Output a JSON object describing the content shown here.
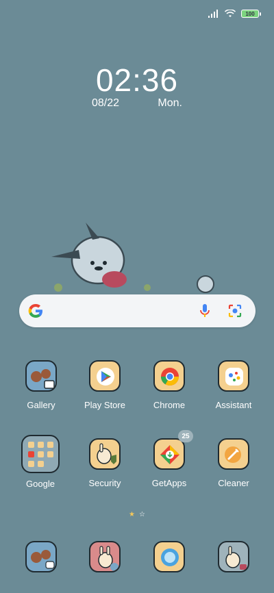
{
  "status_bar": {
    "battery": "100"
  },
  "clock": {
    "time": "02:36",
    "date": "08/22",
    "day": "Mon."
  },
  "search": {
    "mic_icon": "mic-icon",
    "lens_icon": "google-lens-icon"
  },
  "apps_row1": [
    {
      "label": "Gallery"
    },
    {
      "label": "Play Store"
    },
    {
      "label": "Chrome"
    },
    {
      "label": "Assistant"
    }
  ],
  "apps_row2": [
    {
      "label": "Google"
    },
    {
      "label": "Security"
    },
    {
      "label": "GetApps"
    },
    {
      "label": "Cleaner"
    }
  ],
  "getapps_badge": "25",
  "colors": {
    "background": "#6b8b96",
    "search_bg": "#f3f5f7",
    "icon_bg": "#f4d08f"
  }
}
